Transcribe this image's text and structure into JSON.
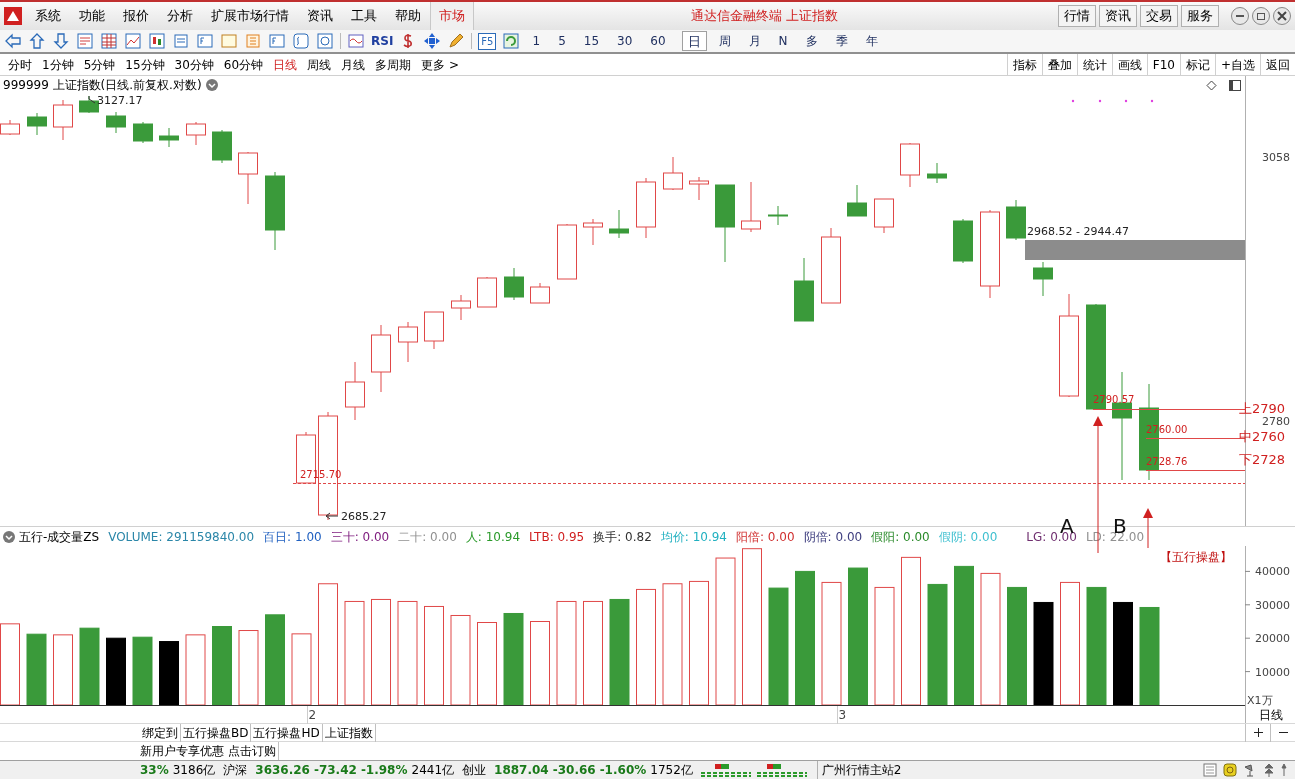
{
  "menu": [
    {
      "label": "系统",
      "selected": false
    },
    {
      "label": "功能",
      "selected": false
    },
    {
      "label": "报价",
      "selected": false
    },
    {
      "label": "分析",
      "selected": false
    },
    {
      "label": "扩展市场行情",
      "selected": false
    },
    {
      "label": "资讯",
      "selected": false
    },
    {
      "label": "工具",
      "selected": false
    },
    {
      "label": "帮助",
      "selected": false
    },
    {
      "label": "市场",
      "selected": true
    }
  ],
  "window_title": "通达信金融终端 上证指数",
  "top_buttons": [
    "行情",
    "资讯",
    "交易",
    "服务"
  ],
  "toolbar": {
    "rsi": "RSI",
    "f5": "F5",
    "periods": [
      {
        "label": "1",
        "selected": false
      },
      {
        "label": "5",
        "selected": false
      },
      {
        "label": "15",
        "selected": false
      },
      {
        "label": "30",
        "selected": false
      },
      {
        "label": "60",
        "selected": false
      },
      {
        "label": "日",
        "selected": true
      },
      {
        "label": "周",
        "selected": false
      },
      {
        "label": "月",
        "selected": false
      },
      {
        "label": "N",
        "selected": false
      },
      {
        "label": "多",
        "selected": false
      },
      {
        "label": "季",
        "selected": false
      },
      {
        "label": "年",
        "selected": false
      }
    ]
  },
  "period_tabs": [
    {
      "label": "分时",
      "selected": false
    },
    {
      "label": "1分钟",
      "selected": false
    },
    {
      "label": "5分钟",
      "selected": false
    },
    {
      "label": "15分钟",
      "selected": false
    },
    {
      "label": "30分钟",
      "selected": false
    },
    {
      "label": "60分钟",
      "selected": false
    },
    {
      "label": "日线",
      "selected": true
    },
    {
      "label": "周线",
      "selected": false
    },
    {
      "label": "月线",
      "selected": false
    },
    {
      "label": "多周期",
      "selected": false
    },
    {
      "label": "更多 >",
      "selected": false
    }
  ],
  "right_tools": [
    "指标",
    "叠加",
    "统计",
    "画线",
    "F10",
    "标记",
    "+自选",
    "返回"
  ],
  "main_chart": {
    "title": "999999 上证指数(日线.前复权.对数)",
    "price_labels": [
      "3058",
      "2780"
    ],
    "high_label": "3127.17",
    "low_label": "2685.27",
    "band_label": "2968.52 - 2944.47",
    "level_labels": [
      {
        "value": "2790.57",
        "tag": "上2790"
      },
      {
        "value": "2760.00",
        "tag": "中2760"
      },
      {
        "value": "2728.76",
        "tag": "下2728"
      }
    ],
    "support_label": "2715.70",
    "markers": [
      "A",
      "B"
    ],
    "signal": "【五行操盘】"
  },
  "indicator": {
    "name": "五行-成交量ZS",
    "values": [
      {
        "label": "VOLUME: 291159840.00",
        "color": "#2a86a8"
      },
      {
        "label": "百日: 1.00",
        "color": "#2060c0"
      },
      {
        "label": "三十: 0.00",
        "color": "#802080"
      },
      {
        "label": "二十: 0.00",
        "color": "#909090"
      },
      {
        "label": "人: 10.94",
        "color": "#2a9a2a"
      },
      {
        "label": "LTB: 0.95",
        "color": "#d02020"
      },
      {
        "label": "换手: 0.82",
        "color": "#333333"
      },
      {
        "label": "均价: 10.94",
        "color": "#20b0c0"
      },
      {
        "label": "阳倍: 0.00",
        "color": "#d03030"
      },
      {
        "label": "阴倍: 0.00",
        "color": "#404080"
      },
      {
        "label": "假阳: 0.00",
        "color": "#2a8a2a"
      },
      {
        "label": "假阴: 0.00",
        "color": "#40c0d0"
      },
      {
        "label": "LG: 0.00",
        "color": "#703070"
      },
      {
        "label": "LD: 22.00",
        "color": "#909090"
      }
    ]
  },
  "volume_chart": {
    "axis_labels": [
      "40000",
      "30000",
      "20000",
      "10000"
    ],
    "unit": "X1万",
    "date_labels": [
      "2",
      "3"
    ]
  },
  "axis_period": "日线",
  "bottom_tabs": [
    "绑定到",
    "五行操盘BD",
    "五行操盘HD",
    "上证指数"
  ],
  "promo": [
    "新用户专享优惠",
    "点击订购"
  ],
  "status": {
    "items": [
      {
        "text": "33%",
        "kind": "change"
      },
      {
        "text": "3186亿",
        "kind": "plain"
      },
      {
        "text": "沪深",
        "kind": "plain"
      },
      {
        "text": "3636.26",
        "kind": "change"
      },
      {
        "text": "-73.42",
        "kind": "change"
      },
      {
        "text": "-1.98%",
        "kind": "change"
      },
      {
        "text": "2441亿",
        "kind": "plain"
      },
      {
        "text": "创业",
        "kind": "plain"
      },
      {
        "text": "1887.04",
        "kind": "change"
      },
      {
        "text": "-30.66",
        "kind": "change"
      },
      {
        "text": "-1.60%",
        "kind": "change"
      },
      {
        "text": "1752亿",
        "kind": "plain"
      }
    ],
    "server": "广州行情主站2"
  }
}
